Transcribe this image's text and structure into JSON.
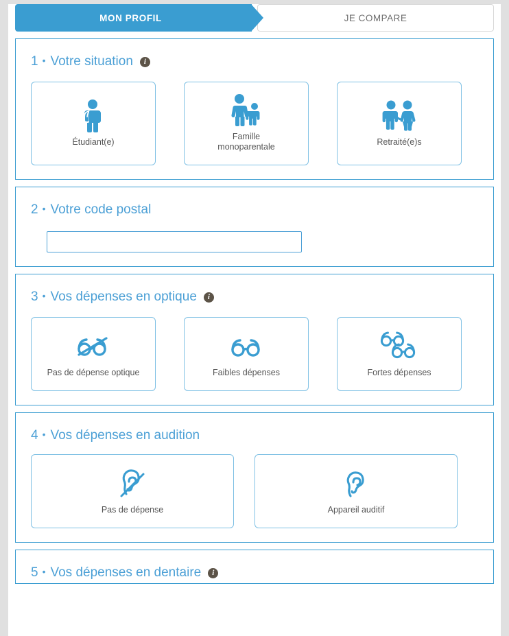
{
  "colors": {
    "accent": "#3a9dd1",
    "header_text": "#4ca0d6",
    "card_border": "#7ec0e4",
    "info_badge": "#5c5347",
    "page_edge": "#e0e0e0",
    "label_text": "#555555"
  },
  "tabs": [
    {
      "label": "MON PROFIL",
      "active": true
    },
    {
      "label": "JE COMPARE",
      "active": false
    }
  ],
  "sections": [
    {
      "number": "1",
      "separator": "•",
      "title": "Votre situation",
      "has_info": true,
      "info_glyph": "i",
      "options": [
        {
          "label": "Étudiant(e)",
          "icon": "student-icon"
        },
        {
          "label": "Famille\nmonoparentale",
          "icon": "single-parent-family-icon"
        },
        {
          "label": "Retraité(e)s",
          "icon": "retired-couple-icon"
        }
      ]
    },
    {
      "number": "2",
      "separator": "•",
      "title": "Votre code postal",
      "has_info": false,
      "input": {
        "value": "",
        "placeholder": ""
      }
    },
    {
      "number": "3",
      "separator": "•",
      "title": "Vos dépenses en optique",
      "has_info": true,
      "info_glyph": "i",
      "options": [
        {
          "label": "Pas de dépense optique",
          "icon": "glasses-crossed-icon"
        },
        {
          "label": "Faibles dépenses",
          "icon": "glasses-single-icon"
        },
        {
          "label": "Fortes dépenses",
          "icon": "glasses-double-icon"
        }
      ]
    },
    {
      "number": "4",
      "separator": "•",
      "title": "Vos dépenses en audition",
      "has_info": false,
      "options": [
        {
          "label": "Pas de dépense",
          "icon": "ear-crossed-icon"
        },
        {
          "label": "Appareil auditif",
          "icon": "ear-hearing-aid-icon"
        }
      ]
    },
    {
      "number": "5",
      "separator": "•",
      "title": "Vos dépenses en dentaire",
      "has_info": true,
      "info_glyph": "i"
    }
  ]
}
